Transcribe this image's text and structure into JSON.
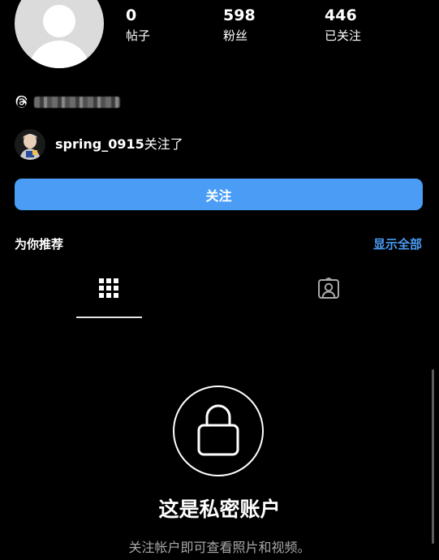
{
  "profile": {
    "posts_count": "0",
    "posts_label": "帖子",
    "followers_count": "598",
    "followers_label": "粉丝",
    "following_count": "446",
    "following_label": "已关注"
  },
  "followed_by": {
    "username": "spring_0915",
    "suffix": "关注了"
  },
  "actions": {
    "follow_label": "关注"
  },
  "suggested": {
    "title": "为你推荐",
    "see_all_label": "显示全部"
  },
  "tabs": [
    {
      "icon": "grid-icon",
      "active": true
    },
    {
      "icon": "tagged-person-icon",
      "active": false
    }
  ],
  "private_account": {
    "title": "这是私密账户",
    "subtitle": "关注帐户即可查看照片和视频。"
  },
  "colors": {
    "background": "#000000",
    "accent": "#4a9cf5",
    "secondary_text": "#a8a8a8",
    "avatar_placeholder": "#dbdbdb"
  }
}
